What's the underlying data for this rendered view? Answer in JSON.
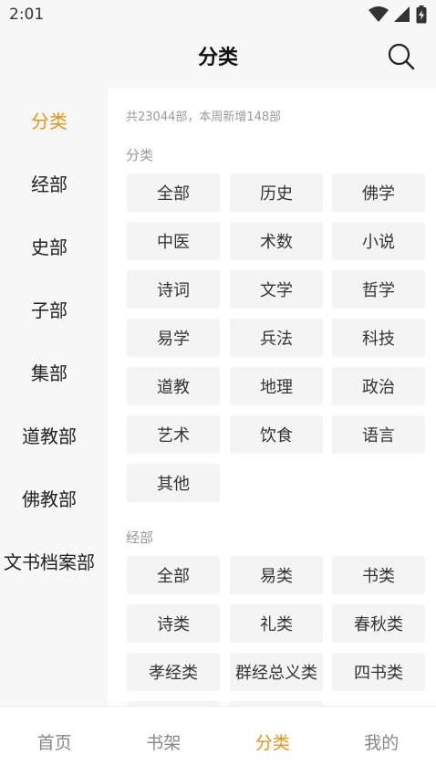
{
  "status": {
    "time": "2:01"
  },
  "header": {
    "title": "分类"
  },
  "sidebar": {
    "items": [
      {
        "label": "分类",
        "active": true
      },
      {
        "label": "经部"
      },
      {
        "label": "史部"
      },
      {
        "label": "子部"
      },
      {
        "label": "集部"
      },
      {
        "label": "道教部"
      },
      {
        "label": "佛教部"
      },
      {
        "label": "文书档案部"
      }
    ]
  },
  "main": {
    "summary": "共23044部，本周新增148部",
    "sections": [
      {
        "title": "分类",
        "chips": [
          "全部",
          "历史",
          "佛学",
          "中医",
          "术数",
          "小说",
          "诗词",
          "文学",
          "哲学",
          "易学",
          "兵法",
          "科技",
          "道教",
          "地理",
          "政治",
          "艺术",
          "饮食",
          "语言",
          "其他"
        ]
      },
      {
        "title": "经部",
        "chips": [
          "全部",
          "易类",
          "书类",
          "诗类",
          "礼类",
          "春秋类",
          "孝经类",
          "群经总义类",
          "四书类"
        ]
      }
    ]
  },
  "bottom_nav": {
    "items": [
      {
        "label": "首页"
      },
      {
        "label": "书架"
      },
      {
        "label": "分类",
        "active": true
      },
      {
        "label": "我的"
      }
    ]
  },
  "colors": {
    "accent": "#e0951b",
    "chip_bg": "#f4f4f4",
    "muted": "#999999"
  },
  "icons": {
    "wifi": "wifi-icon",
    "signal": "signal-icon",
    "battery": "battery-icon",
    "search": "search-icon"
  }
}
